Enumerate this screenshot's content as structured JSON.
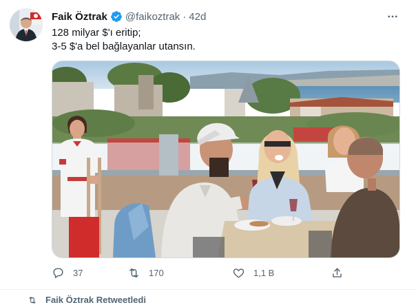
{
  "tweet": {
    "author_name": "Faik Öztrak",
    "author_handle": "@faikoztrak",
    "separator": "·",
    "timestamp": "42d",
    "text_lines": [
      "128 milyar $'ı eritip;",
      "3-5 $'a bel bağlayanlar utansın."
    ],
    "media_alt": "Photo of a rooftop restaurant terrace overlooking the Bosphorus with diners and a waitress",
    "stats": {
      "replies": "37",
      "retweets": "170",
      "likes": "1,1 B"
    }
  },
  "next_item": {
    "text": "Faik Öztrak Retweetledi"
  },
  "colors": {
    "text_primary": "#0f1419",
    "text_secondary": "#536471",
    "verified_blue": "#1d9bf0",
    "border": "#cfd9de"
  },
  "icons": {
    "more": "more-icon",
    "verified": "verified-badge-icon",
    "reply": "reply-icon",
    "retweet": "retweet-icon",
    "like": "like-icon",
    "share": "share-icon",
    "retweeted_by": "retweet-icon"
  }
}
